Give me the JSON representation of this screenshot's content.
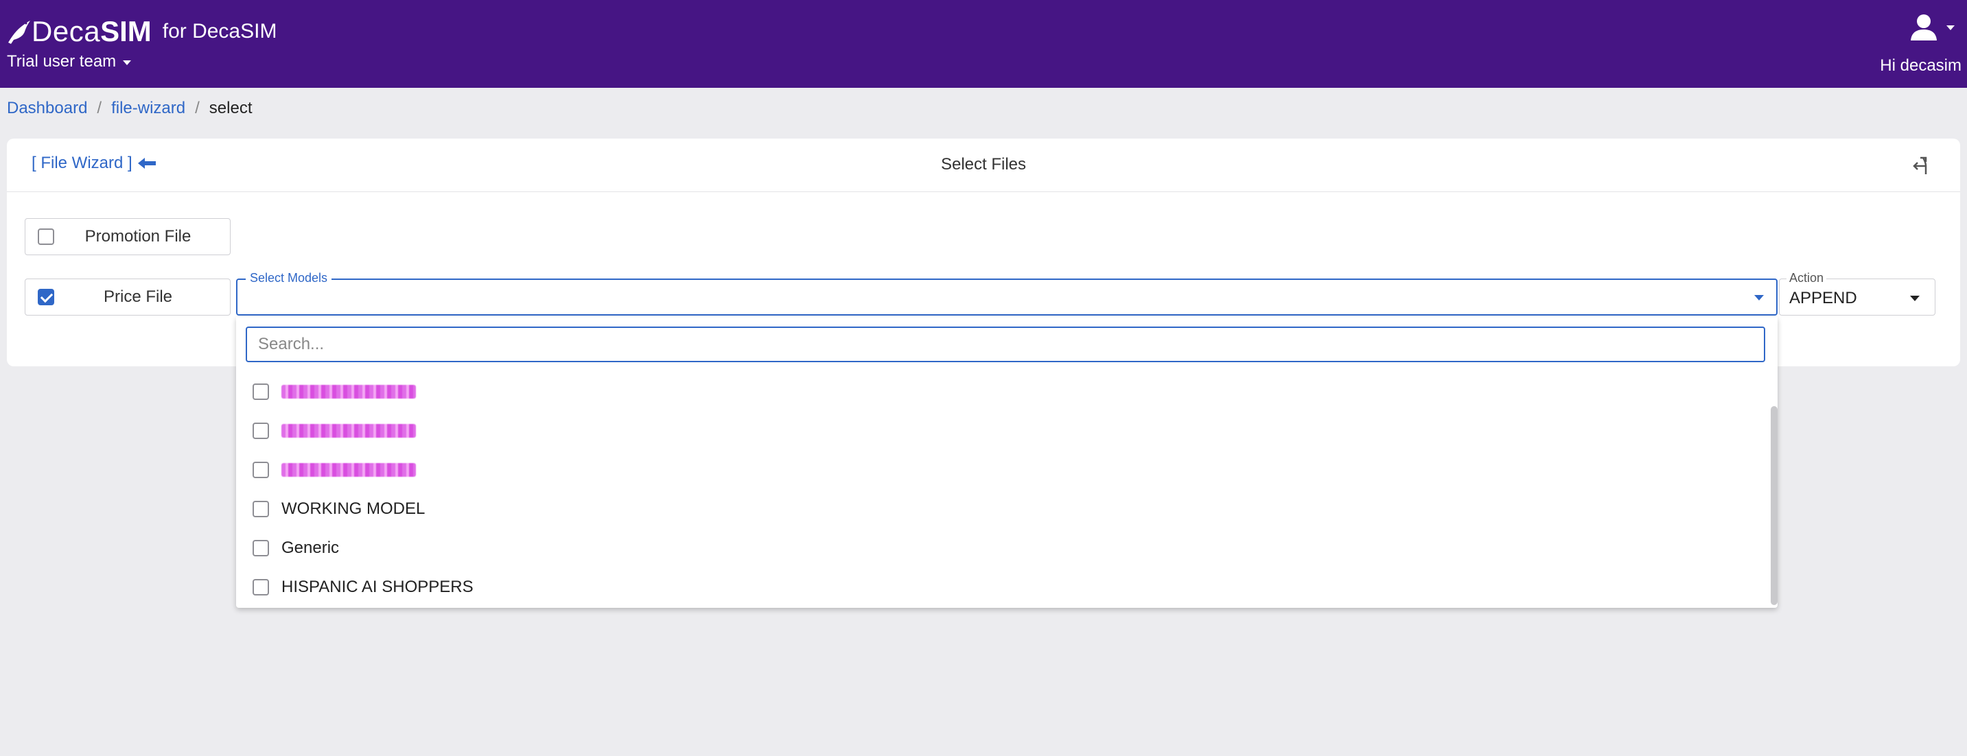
{
  "header": {
    "logo_deca": "Deca",
    "logo_sim": "SIM",
    "logo_for": "for DecaSIM",
    "team": "Trial user team",
    "greeting": "Hi decasim"
  },
  "breadcrumb": {
    "items": [
      "Dashboard",
      "file-wizard",
      "select"
    ],
    "separator": "/"
  },
  "card": {
    "wizard_link": "[ File Wizard ]",
    "title": "Select Files"
  },
  "files": [
    {
      "label": "Promotion File",
      "checked": false
    },
    {
      "label": "Price File",
      "checked": true
    }
  ],
  "select_models": {
    "legend": "Select Models",
    "value": ""
  },
  "action": {
    "legend": "Action",
    "value": "APPEND"
  },
  "dropdown": {
    "search_placeholder": "Search...",
    "options": [
      {
        "label": "",
        "redacted": true,
        "checked": false
      },
      {
        "label": "",
        "redacted": true,
        "checked": false
      },
      {
        "label": "",
        "redacted": true,
        "checked": false
      },
      {
        "label": "WORKING MODEL",
        "redacted": false,
        "checked": false
      },
      {
        "label": "Generic",
        "redacted": false,
        "checked": false
      },
      {
        "label": "HISPANIC AI SHOPPERS",
        "redacted": false,
        "checked": false
      }
    ]
  },
  "colors": {
    "header_bg": "#461584",
    "accent": "#2f67c7",
    "page_bg": "#ececef"
  }
}
